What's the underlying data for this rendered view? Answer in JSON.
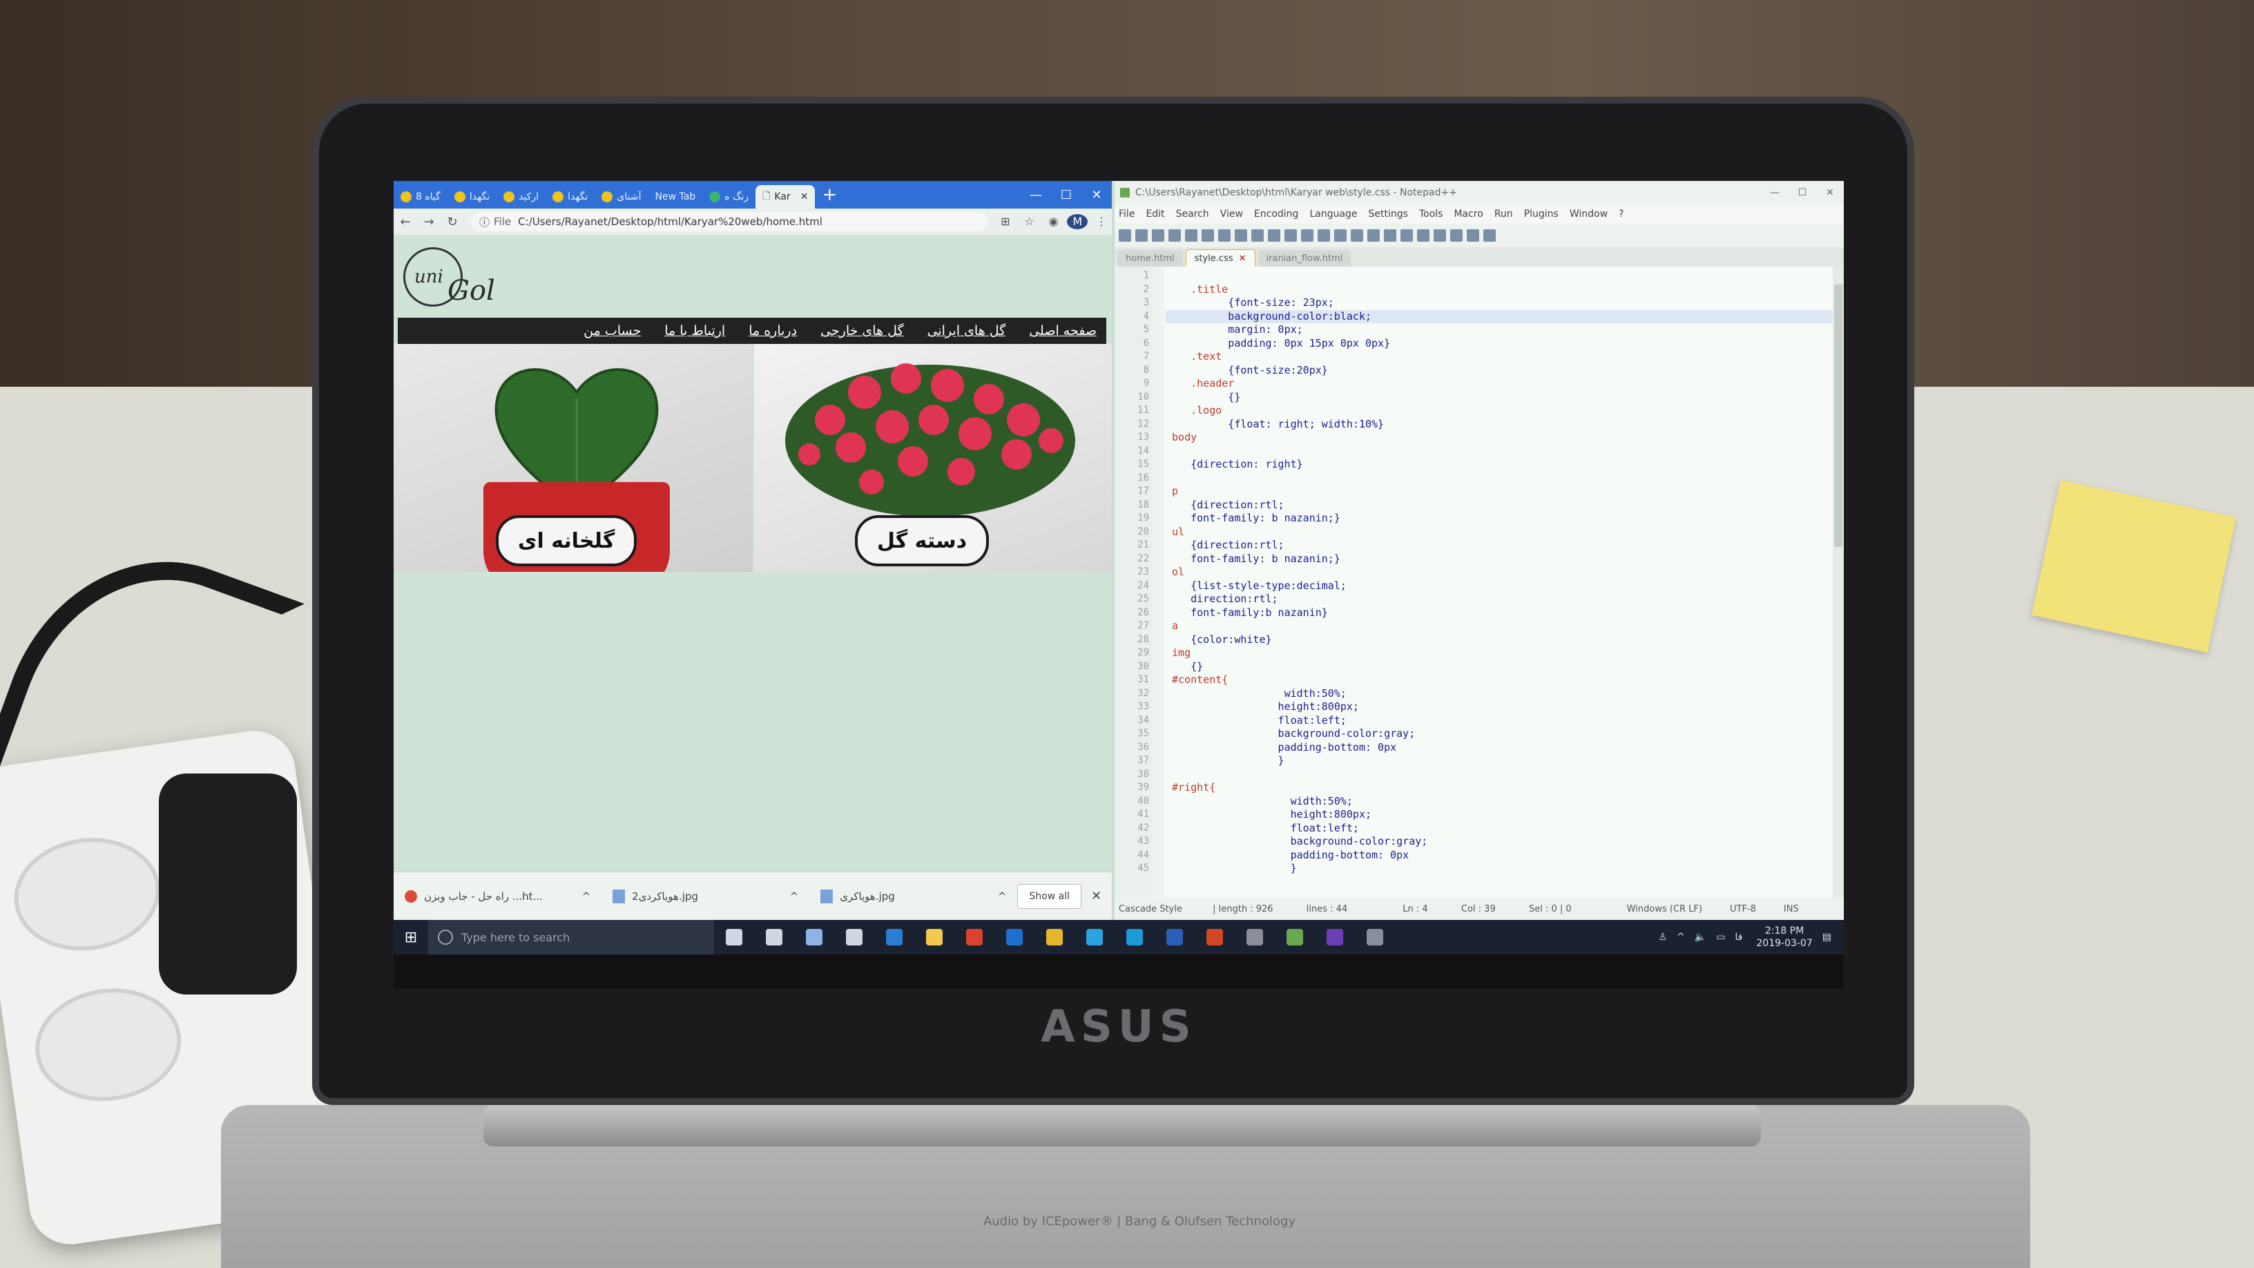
{
  "browser": {
    "tabs": [
      {
        "label": "8 گیاه"
      },
      {
        "label": "نگهدا"
      },
      {
        "label": "ارکید"
      },
      {
        "label": "نگهدا"
      },
      {
        "label": "آشنای"
      },
      {
        "label": "New Tab"
      },
      {
        "label": "رنگ ه"
      },
      {
        "label": "Kar",
        "active": true
      }
    ],
    "new_tab": "+",
    "window_controls": {
      "minimize": "—",
      "maximize": "☐",
      "close": "✕"
    },
    "address": {
      "scheme_label": "File",
      "url": "C:/Users/Rayanet/Desktop/html/Karyar%20web/home.html"
    },
    "profile_initial": "M"
  },
  "site": {
    "logo_text_1": "uni",
    "logo_text_2": "Gol",
    "menu": [
      "صفحه اصلی",
      "گل های ایرانی",
      "گل های خارجی",
      "درباره ما",
      "ارتباط با ما",
      "حساب من"
    ],
    "cards": {
      "left_label": "گلخانه ای",
      "right_label": "دسته گل"
    }
  },
  "downloads": {
    "items": [
      {
        "name": "راه حل - جاب وبزن ...ht...",
        "icon": "chrome-icon"
      },
      {
        "name": "هویاکردی2.jpg",
        "icon": "image-file-icon"
      },
      {
        "name": "هویاکری.jpg",
        "icon": "image-file-icon"
      }
    ],
    "show_all": "Show all",
    "close": "✕"
  },
  "notepad": {
    "title": "C:\\Users\\Rayanet\\Desktop\\html\\Karyar web\\style.css - Notepad++",
    "menu": [
      "File",
      "Edit",
      "Search",
      "View",
      "Encoding",
      "Language",
      "Settings",
      "Tools",
      "Macro",
      "Run",
      "Plugins",
      "Window",
      "?"
    ],
    "tabs": [
      {
        "label": "home.html"
      },
      {
        "label": "style.css",
        "active": true
      },
      {
        "label": "iranian_flow.html"
      }
    ],
    "code": [
      "",
      "    .title",
      "          {font-size: 23px;",
      "          background-color:black;",
      "          margin: 0px;",
      "          padding: 0px 15px 0px 0px}",
      "    .text",
      "          {font-size:20px}",
      "    .header",
      "          {}",
      "    .logo",
      "          {float: right; width:10%}",
      " body",
      "",
      "    {direction: right}",
      "",
      " p",
      "    {direction:rtl;",
      "    font-family: b nazanin;}",
      " ul",
      "    {direction:rtl;",
      "    font-family: b nazanin;}",
      " ol",
      "    {list-style-type:decimal;",
      "    direction:rtl;",
      "    font-family:b nazanin}",
      " a",
      "    {color:white}",
      " img",
      "    {}",
      " #content{",
      "                   width:50%;",
      "                  height:800px;",
      "                  float:left;",
      "                  background-color:gray;",
      "                  padding-bottom: 0px",
      "                  }",
      "",
      " #right{",
      "                    width:50%;",
      "                    height:800px;",
      "                    float:left;",
      "                    background-color:gray;",
      "                    padding-bottom: 0px",
      "                    }"
    ],
    "status": {
      "type": "Cascade Style",
      "length": "length : 926",
      "lines": "lines : 44",
      "ln": "Ln : 4",
      "col": "Col : 39",
      "sel": "Sel : 0 | 0",
      "eol": "Windows (CR LF)",
      "encoding": "UTF-8",
      "mode": "INS"
    }
  },
  "taskbar": {
    "search_placeholder": "Type here to search",
    "time": "2:18 PM",
    "date": "2019-03-07",
    "apps": [
      "mic-icon",
      "task-view-icon",
      "mail-icon",
      "camera-icon",
      "edge-icon",
      "file-explorer-icon",
      "acrobat-icon",
      "photoshop-icon",
      "chrome-icon",
      "telegram-icon",
      "skype-icon",
      "word-icon",
      "powerpoint-icon",
      "network-app-icon",
      "notepadpp-icon",
      "visual-studio-icon",
      "snipping-tool-icon"
    ]
  },
  "device": {
    "brand": "ASUS",
    "base_label": "Audio by ICEpower® | Bang & Olufsen Technology"
  },
  "colors": {
    "browser_tabbar": "#2f6fd6",
    "site_menu_bg": "#222222",
    "taskbar_bg": "#1a2130",
    "npp_selector": "#c0392b"
  }
}
